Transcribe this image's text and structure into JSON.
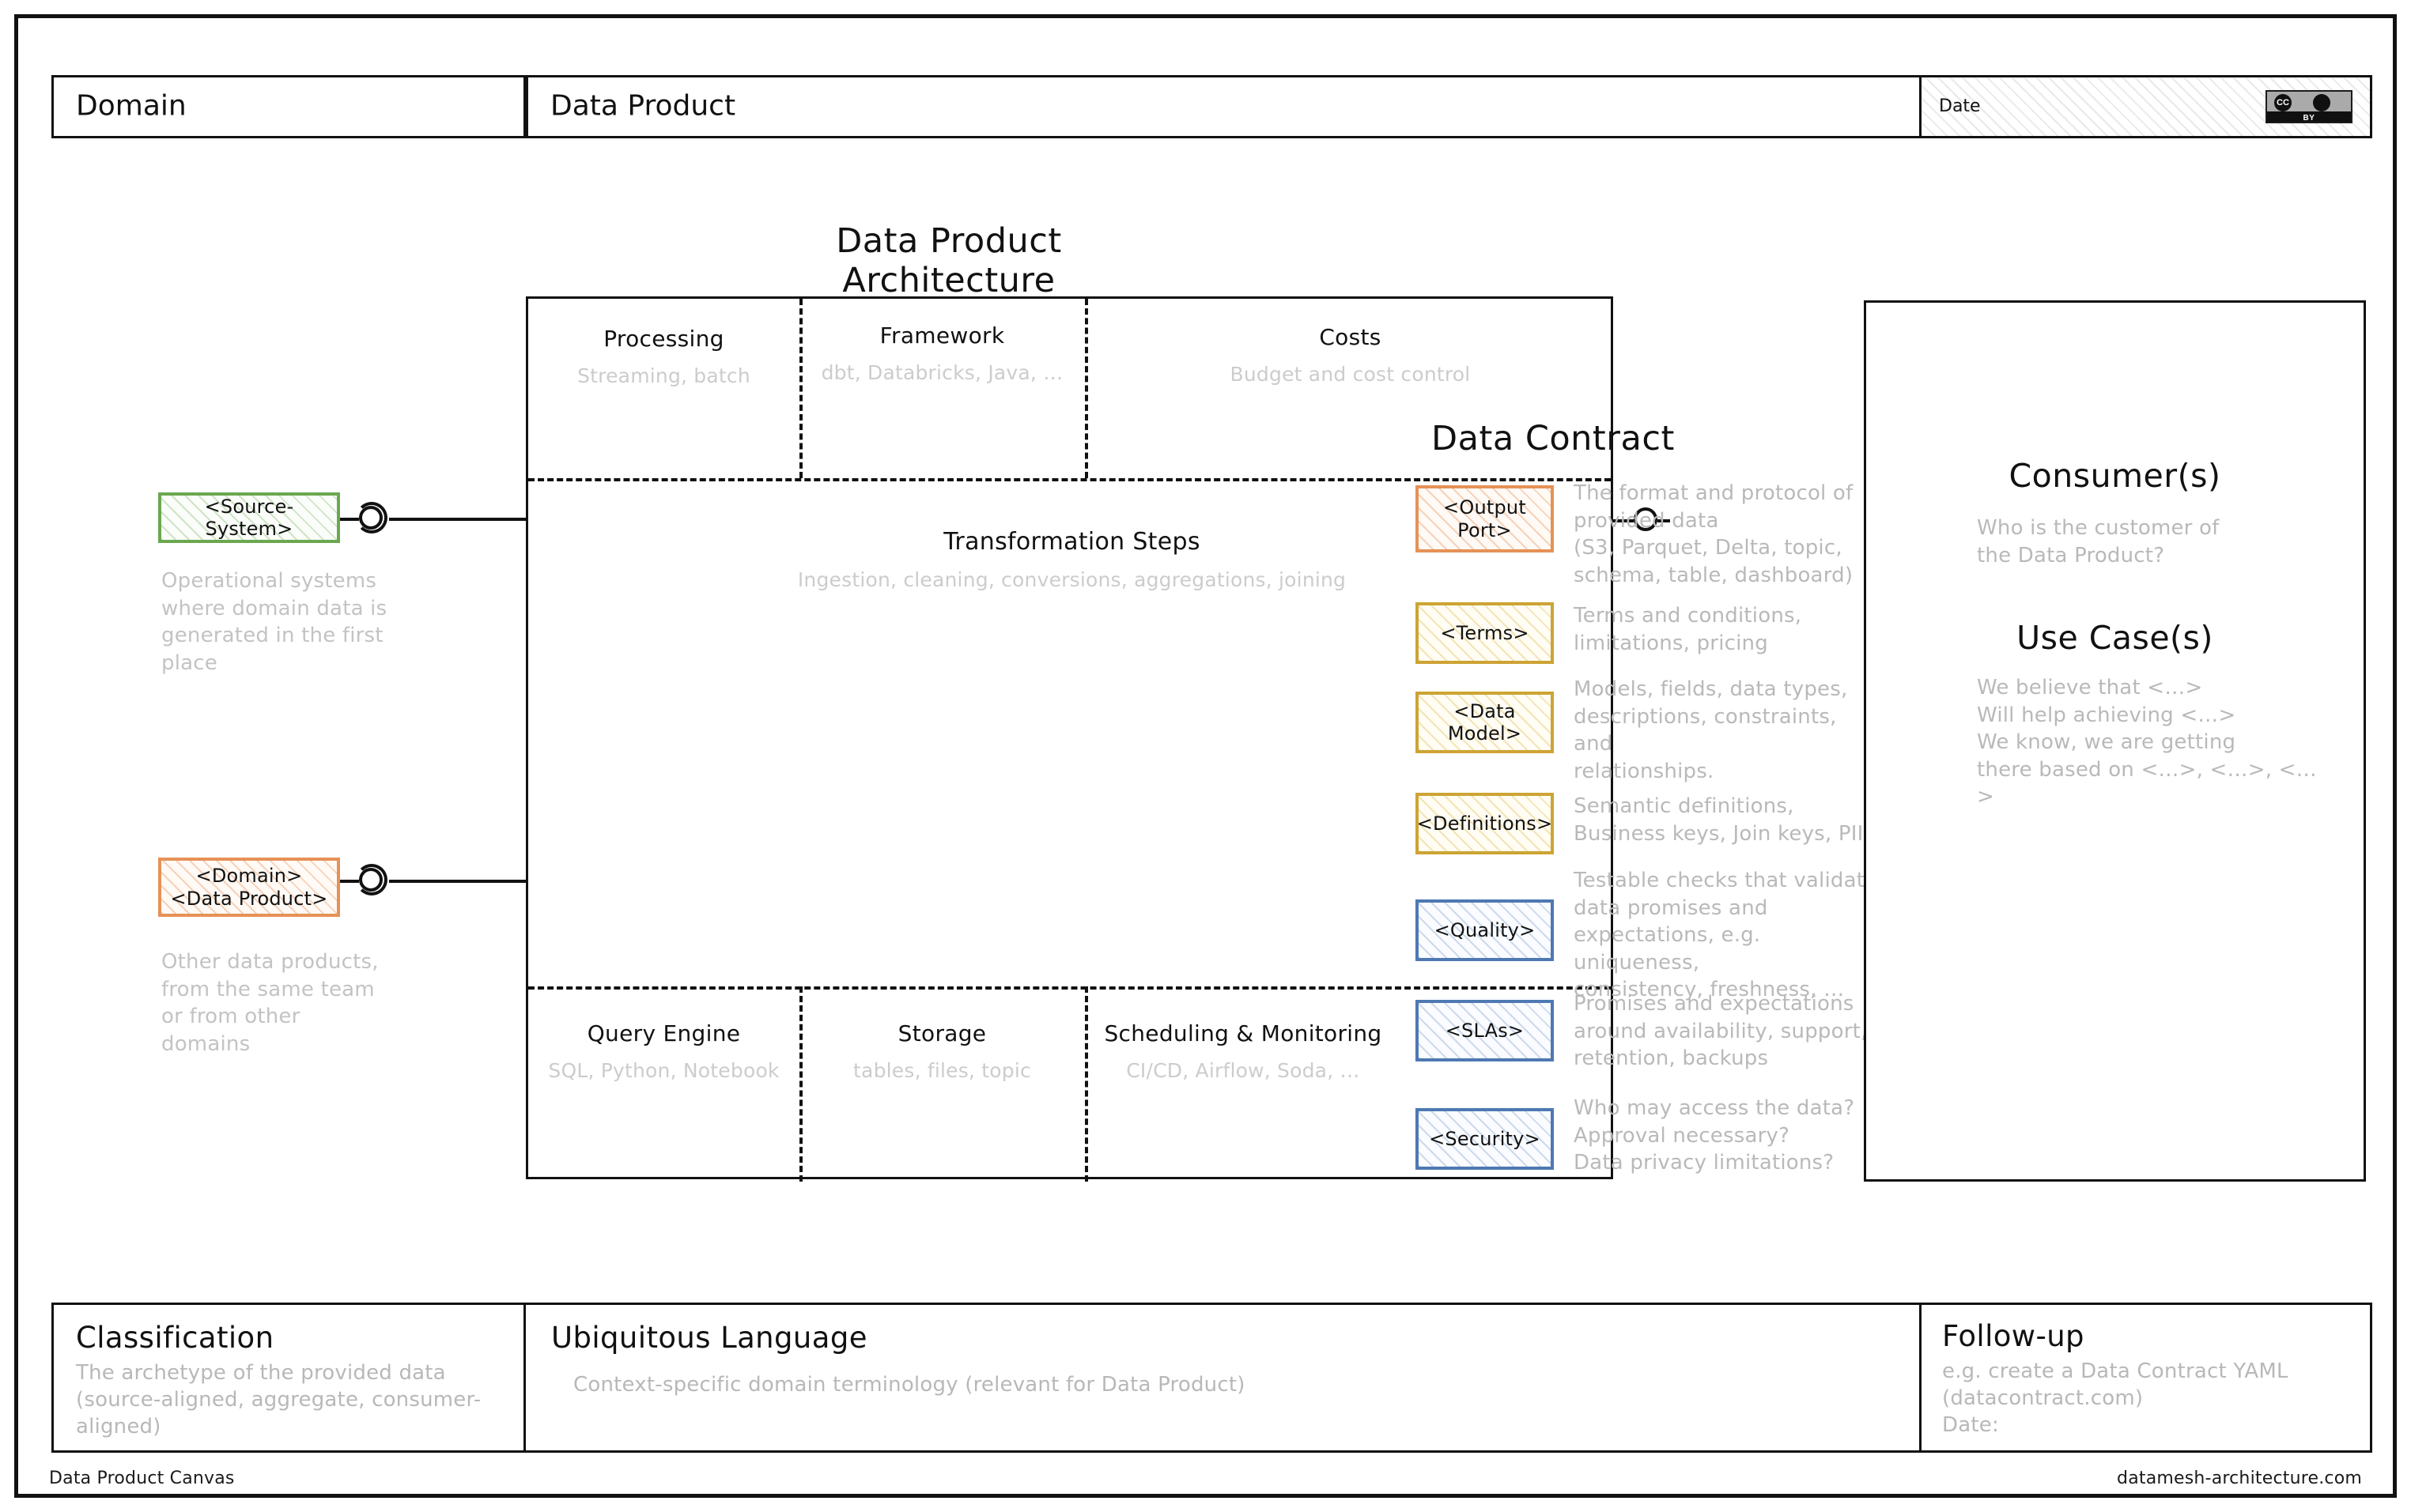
{
  "header": {
    "domain_label": "Domain",
    "product_label": "Data Product",
    "date_label": "Date",
    "license_badge": {
      "cc": "CC",
      "by": "BY"
    }
  },
  "architecture": {
    "title": "Data Product Architecture",
    "top_cells": [
      {
        "title": "Processing",
        "subtitle": "Streaming, batch"
      },
      {
        "title": "Framework",
        "subtitle": "dbt, Databricks, Java, …"
      },
      {
        "title": "Costs",
        "subtitle": "Budget and cost control"
      }
    ],
    "middle_cell": {
      "title": "Transformation Steps",
      "subtitle": "Ingestion, cleaning, conversions, aggregations, joining"
    },
    "bottom_cells": [
      {
        "title": "Query Engine",
        "subtitle": "SQL, Python, Notebook"
      },
      {
        "title": "Storage",
        "subtitle": "tables, files, topic"
      },
      {
        "title": "Scheduling & Monitoring",
        "subtitle": "CI/CD, Airflow, Soda, …"
      }
    ]
  },
  "inputs": [
    {
      "chip": "<Source-System>",
      "style": "green",
      "note": "Operational systems\nwhere domain data is\ngenerated in the first\nplace"
    },
    {
      "chip_line1": "<Domain>",
      "chip_line2": "<Data Product>",
      "style": "orange",
      "note": "Other data products,\nfrom the same team\nor from other\ndomains"
    }
  ],
  "data_contract": {
    "title": "Data Contract",
    "items": [
      {
        "label": "<Output\nPort>",
        "style": "orange",
        "description": "The format and protocol of\nprovided data\n(S3, Parquet, Delta, topic,\nschema, table, dashboard)"
      },
      {
        "label": "<Terms>",
        "style": "yellow",
        "description": "Terms and conditions,\nlimitations, pricing"
      },
      {
        "label": "<Data Model>",
        "style": "yellow",
        "description": "Models, fields, data types,\ndescriptions, constraints, and\nrelationships."
      },
      {
        "label": "<Definitions>",
        "style": "yellow",
        "description": "Semantic definitions,\nBusiness keys, Join keys, PII"
      },
      {
        "label": "<Quality>",
        "style": "blue",
        "description": "Testable checks that validate\ndata promises and\nexpectations, e.g. uniqueness,\nconsistency, freshness, …"
      },
      {
        "label": "<SLAs>",
        "style": "blue",
        "description": "Promises and expectations\naround availability, support,\nretention, backups"
      },
      {
        "label": "<Security>",
        "style": "blue",
        "description": "Who may access the data?\nApproval necessary?\nData privacy limitations?"
      }
    ]
  },
  "consumers": {
    "heading": "Consumer(s)",
    "body": "Who is the customer of\nthe Data Product?",
    "usecase_heading": "Use Case(s)",
    "usecase_body": "We believe that <…>\nWill help achieving <…>\nWe know, we are getting\nthere based on <…>, <…>, <…>"
  },
  "bottom": {
    "classification": {
      "title": "Classification",
      "body": "The archetype of the provided data\n(source-aligned, aggregate, consumer-aligned)"
    },
    "ubiquitous": {
      "title": "Ubiquitous Language",
      "body": "Context-specific domain terminology (relevant for Data Product)"
    },
    "followup": {
      "title": "Follow-up",
      "body": "e.g. create a Data Contract YAML\n(datacontract.com)\nDate:"
    }
  },
  "footer": {
    "left": "Data Product Canvas",
    "right": "datamesh-architecture.com"
  },
  "colors": {
    "green": "#6aa84f",
    "orange": "#e69156",
    "yellow": "#cda434",
    "blue": "#4e79b2",
    "ink": "#111111",
    "muted": "#bdbdbd"
  }
}
